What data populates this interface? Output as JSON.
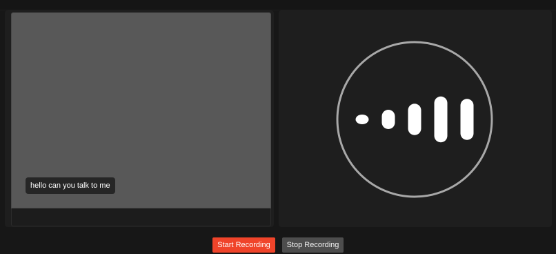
{
  "caption": {
    "text": "hello can you talk to me"
  },
  "audio_visualizer": {
    "icon": "audio-level-bars-icon",
    "levels": [
      0.15,
      0.4,
      0.65,
      0.95,
      0.85
    ]
  },
  "controls": {
    "start_label": "Start Recording",
    "stop_label": "Stop Recording"
  },
  "colors": {
    "start_button": "#f0442a",
    "stop_button": "#4d4d4d",
    "ring": "#a8a8a8",
    "bars": "#ffffff"
  }
}
